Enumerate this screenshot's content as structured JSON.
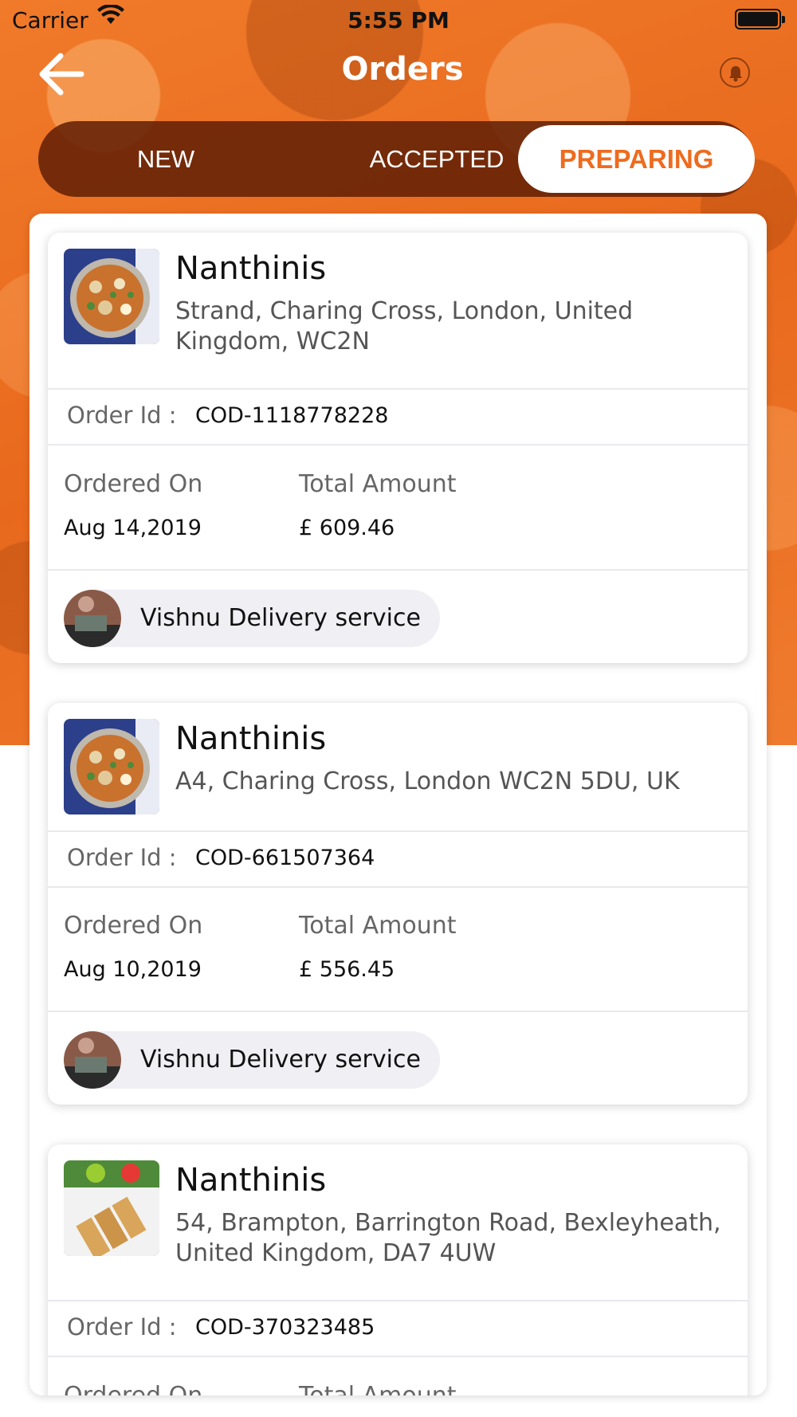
{
  "status_bar": {
    "carrier": "Carrier",
    "time": "5:55 PM"
  },
  "header": {
    "title": "Orders",
    "back_icon": "back-arrow-icon",
    "bell_icon": "bell-icon"
  },
  "tabs": [
    {
      "label": "NEW",
      "active": false
    },
    {
      "label": "ACCEPTED",
      "active": false
    },
    {
      "label": "PREPARING",
      "active": true
    }
  ],
  "colors": {
    "accent": "#ee6b1f",
    "tab_bar": "#5f1e05",
    "pill_bg": "#efeff4"
  },
  "labels": {
    "order_id": "Order Id :",
    "ordered_on": "Ordered On",
    "total_amount": "Total Amount"
  },
  "orders": [
    {
      "restaurant": "Nanthinis",
      "address": "Strand, Charing Cross, London, United Kingdom, WC2N",
      "order_id": "COD-1118778228",
      "ordered_on": "Aug 14,2019",
      "total": "£ 609.46",
      "delivery": "Vishnu Delivery service"
    },
    {
      "restaurant": "Nanthinis",
      "address": "A4, Charing Cross, London WC2N 5DU, UK",
      "order_id": "COD-661507364",
      "ordered_on": "Aug 10,2019",
      "total": "£ 556.45",
      "delivery": "Vishnu Delivery service"
    },
    {
      "restaurant": "Nanthinis",
      "address": "54, Brampton, Barrington Road, Bexleyheath, United Kingdom, DA7 4UW",
      "order_id": "COD-370323485",
      "ordered_on": "",
      "total": "",
      "delivery": ""
    }
  ]
}
